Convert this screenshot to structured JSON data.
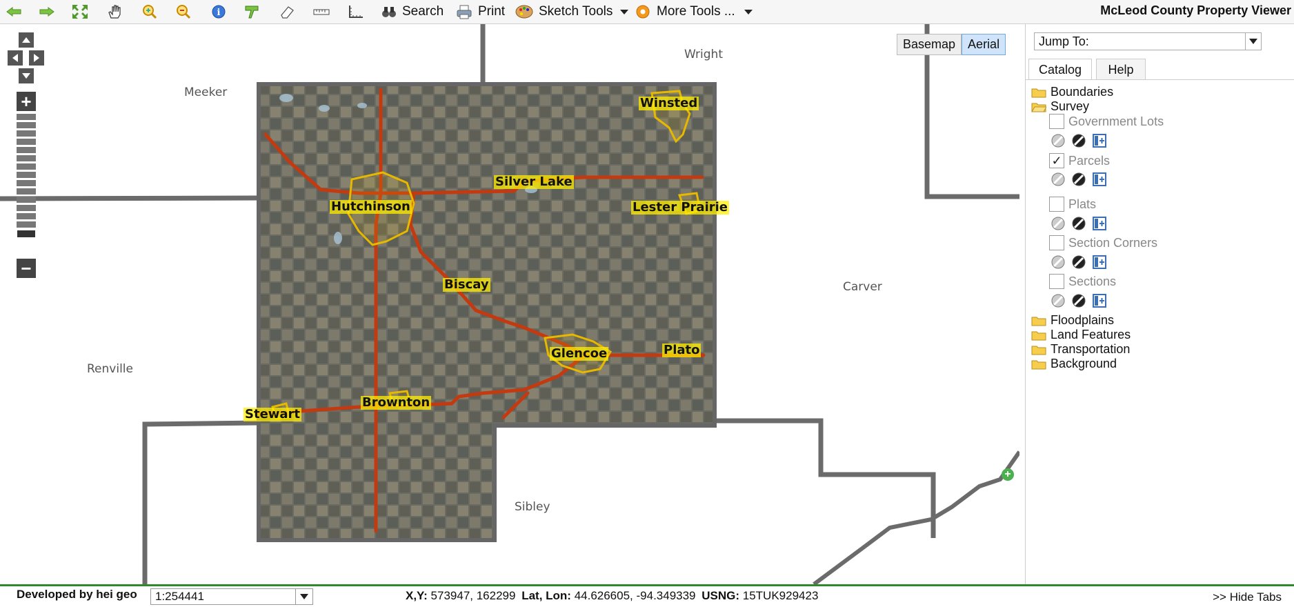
{
  "toolbar": {
    "icons": [
      "back-arrow-icon",
      "forward-arrow-icon",
      "full-extent-icon",
      "pan-hand-icon",
      "zoom-in-icon",
      "zoom-out-icon",
      "identify-icon",
      "highlight-icon",
      "eraser-icon",
      "measure-distance-icon",
      "measure-area-icon"
    ],
    "search_label": "Search",
    "print_label": "Print",
    "sketch_label": "Sketch Tools",
    "more_label": "More Tools ...",
    "title": "McLeod County Property Viewer"
  },
  "map": {
    "basemap_label": "Basemap",
    "aerial_label": "Aerial",
    "active_basemap": "Aerial",
    "counties": {
      "wright": "Wright",
      "meeker": "Meeker",
      "carver": "Carver",
      "renville": "Renville",
      "sibley": "Sibley"
    },
    "cities": {
      "winsted": "Winsted",
      "silver_lake": "Silver Lake",
      "hutchinson": "Hutchinson",
      "lester_prairie": "Lester Prairie",
      "biscay": "Biscay",
      "glencoe": "Glencoe",
      "plato": "Plato",
      "stewart": "Stewart",
      "brownton": "Brownton"
    },
    "colors": {
      "road": "#c43a10",
      "boundary": "#666666",
      "city_outline": "#e6b800",
      "aerial": "#6a6b62"
    }
  },
  "panel": {
    "jump_to": "Jump To:",
    "tabs": {
      "catalog": "Catalog",
      "help": "Help"
    },
    "groups": {
      "boundaries": "Boundaries",
      "survey": "Survey",
      "floodplains": "Floodplains",
      "land_features": "Land Features",
      "transportation": "Transportation",
      "background": "Background"
    },
    "layers": {
      "government_lots": {
        "label": "Government Lots",
        "checked": false
      },
      "parcels": {
        "label": "Parcels",
        "checked": true
      },
      "plats": {
        "label": "Plats",
        "checked": false
      },
      "section_corners": {
        "label": "Section Corners",
        "checked": false
      },
      "sections": {
        "label": "Sections",
        "checked": false
      }
    },
    "check_mark": "✓"
  },
  "status": {
    "developer": "Developed by hei geo",
    "scale": "1:254441",
    "xy_label": "X,Y:",
    "xy_value": "573947, 162299",
    "latlon_label": "Lat, Lon:",
    "latlon_value": "44.626605, -94.349339",
    "usng_label": "USNG:",
    "usng_value": "15TUK929423",
    "hide_tabs": ">> Hide Tabs"
  }
}
